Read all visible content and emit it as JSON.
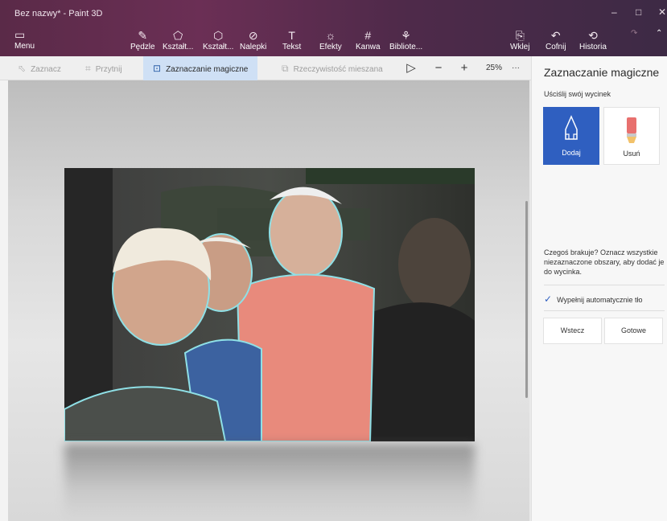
{
  "window": {
    "title": "Bez nazwy* - Paint 3D",
    "controls": {
      "minimize": "–",
      "maximize": "□",
      "close": "✕"
    }
  },
  "ribbon": {
    "menu": {
      "label": "Menu",
      "icon": "folder-icon"
    },
    "tools": [
      {
        "label": "Pędzle",
        "icon": "brush-icon"
      },
      {
        "label": "Kształt...",
        "icon": "2d-shapes-icon"
      },
      {
        "label": "Kształt...",
        "icon": "3d-shapes-icon"
      },
      {
        "label": "Nalepki",
        "icon": "sticker-icon"
      },
      {
        "label": "Tekst",
        "icon": "text-icon"
      },
      {
        "label": "Efekty",
        "icon": "effects-icon"
      },
      {
        "label": "Kanwa",
        "icon": "canvas-icon"
      },
      {
        "label": "Bibliote...",
        "icon": "library-icon"
      }
    ],
    "right_tools": [
      {
        "label": "Wklej",
        "icon": "paste-icon"
      },
      {
        "label": "Cofnij",
        "icon": "undo-icon"
      },
      {
        "label": "Historia",
        "icon": "history-icon"
      }
    ]
  },
  "subbar": {
    "select": "Zaznacz",
    "crop": "Przytnij",
    "magic_select": "Zaznaczanie magiczne",
    "mixed_reality": "Rzeczywistość mieszana",
    "zoom": "25%",
    "more": "···"
  },
  "panel": {
    "title": "Zaznaczanie magiczne",
    "subtitle": "Uściślij swój wycinek",
    "add_label": "Dodaj",
    "remove_label": "Usuń",
    "hint": "Czegoś brakuje? Oznacz wszystkie niezaznaczone obszary, aby dodać je do wycinka.",
    "autofill_label": "Wypełnij automatycznie tło",
    "autofill_checked": true,
    "back_label": "Wstecz",
    "done_label": "Gotowe"
  },
  "colors": {
    "ribbon": "#5a2a48",
    "accent": "#2f5fc0"
  }
}
